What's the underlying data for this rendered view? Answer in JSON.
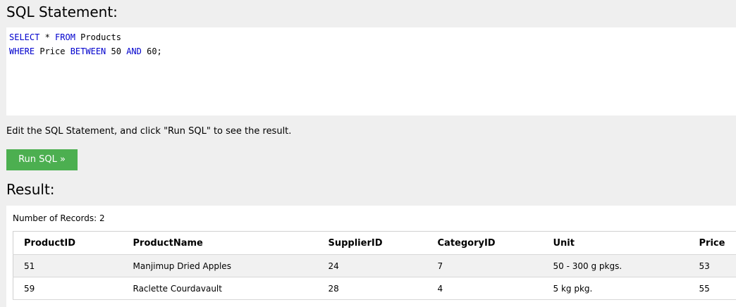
{
  "sql_section": {
    "title": "SQL Statement:",
    "code_line1": {
      "kw1": "SELECT",
      "t1": " * ",
      "kw2": "FROM",
      "t2": " Products"
    },
    "code_line2": {
      "kw1": "WHERE",
      "t1": " Price ",
      "kw2": "BETWEEN",
      "t2": " 50 ",
      "kw3": "AND",
      "t3": " 60;"
    }
  },
  "hint_text": "Edit the SQL Statement, and click \"Run SQL\" to see the result.",
  "run_button": {
    "label": "Run SQL »",
    "color": "#4caf50"
  },
  "result_section": {
    "title": "Result:",
    "record_count": "Number of Records: 2",
    "columns": [
      "ProductID",
      "ProductName",
      "SupplierID",
      "CategoryID",
      "Unit",
      "Price"
    ],
    "rows": [
      [
        "51",
        "Manjimup Dried Apples",
        "24",
        "7",
        "50 - 300 g pkgs.",
        "53"
      ],
      [
        "59",
        "Raclette Courdavault",
        "28",
        "4",
        "5 kg pkg.",
        "55"
      ]
    ]
  },
  "colors": {
    "keyword": "#0000cd",
    "background": "#efefef"
  }
}
